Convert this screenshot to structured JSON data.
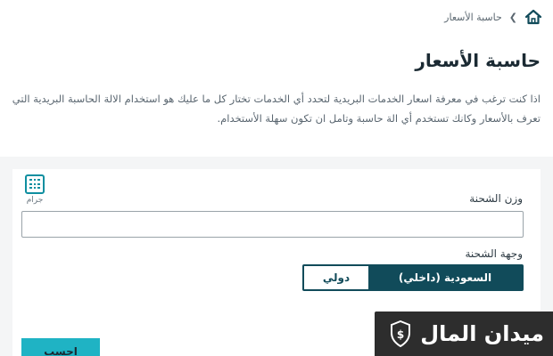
{
  "breadcrumb": {
    "current": "حاسبة الأسعار"
  },
  "page": {
    "title": "حاسبة الأسعار",
    "description": "اذا كنت ترغب في معرفة اسعار الخدمات البريدية لتحدد أي الخدمات تختار كل ما عليك هو استخدام الالة الحاسبة البريدية التي تعرف بالأسعار وكانك تستخدم أي الة حاسبة وتامل ان تكون سهلة الأستخدام."
  },
  "form": {
    "unit_label": "جرام",
    "weight_label": "وزن الشحنة",
    "weight_value": "",
    "destination_label": "وجهة الشحنة",
    "destination_options": [
      "السعودية (داخلي)",
      "دولي"
    ],
    "selected_destination": "السعودية (داخلي)",
    "submit_label": "احسب"
  },
  "watermark": {
    "text": "ميدان المال"
  },
  "colors": {
    "primary_dark": "#114b5a",
    "accent_teal": "#1fb3c4",
    "icon_teal": "#0f8fa0"
  },
  "icons": [
    "home-icon",
    "chevron-left-icon",
    "calculator-icon",
    "shield-dollar-icon"
  ]
}
